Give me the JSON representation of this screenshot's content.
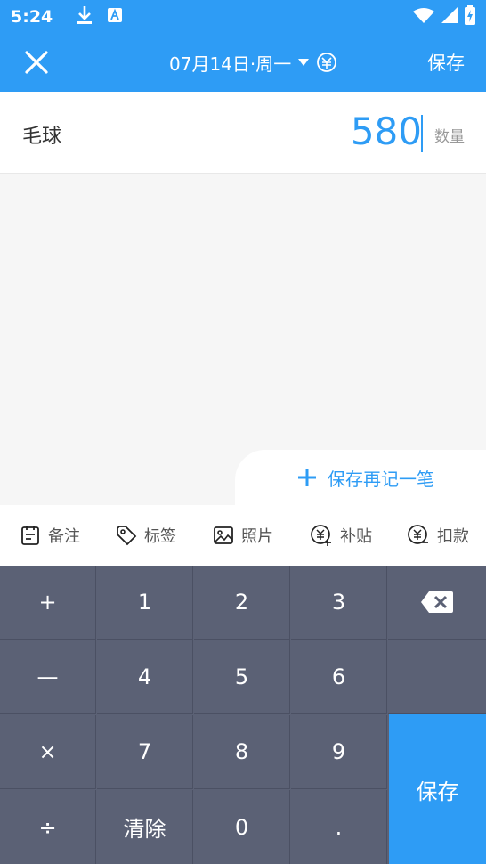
{
  "status_bar": {
    "time": "5:24"
  },
  "header": {
    "date": "07月14日·周一",
    "save_label": "保存"
  },
  "entry": {
    "category": "毛球",
    "amount": "580",
    "unit_label": "数量"
  },
  "save_again_label": "保存再记一笔",
  "tools": [
    {
      "label": "备注",
      "icon": "note-icon"
    },
    {
      "label": "标签",
      "icon": "tag-icon"
    },
    {
      "label": "照片",
      "icon": "photo-icon"
    },
    {
      "label": "补贴",
      "icon": "subsidy-icon"
    },
    {
      "label": "扣款",
      "icon": "deduction-icon"
    }
  ],
  "keypad": {
    "plus": "+",
    "minus": "—",
    "times": "×",
    "divide": "÷",
    "k1": "1",
    "k2": "2",
    "k3": "3",
    "k4": "4",
    "k5": "5",
    "k6": "6",
    "k7": "7",
    "k8": "8",
    "k9": "9",
    "clear": "清除",
    "k0": "0",
    "dot": ".",
    "save": "保存"
  },
  "colors": {
    "accent": "#2e9cf5",
    "keypad": "#5b6175"
  }
}
